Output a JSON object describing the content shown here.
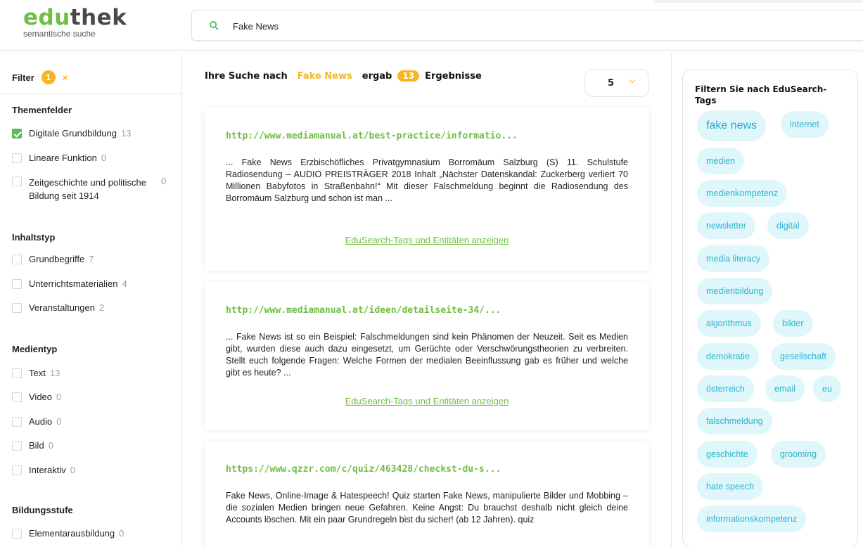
{
  "logo": {
    "brand_a": "edu",
    "brand_b": "thek",
    "subtitle": "semantische suche"
  },
  "search": {
    "value": "Fake News",
    "placeholder": ""
  },
  "filter": {
    "label": "Filter",
    "count": "1",
    "clear": "×",
    "sections": {
      "themenfelder": {
        "title": "Themenfelder",
        "items": [
          {
            "label": "Digitale Grundbildung",
            "count": "13",
            "checked": true
          },
          {
            "label": "Lineare Funktion",
            "count": "0"
          },
          {
            "label": "Zeitgeschichte und politische Bildung seit 1914",
            "count": "0"
          }
        ]
      },
      "inhaltstyp": {
        "title": "Inhaltstyp",
        "items": [
          {
            "label": "Grundbegriffe",
            "count": "7"
          },
          {
            "label": "Unterrichtsmaterialien",
            "count": "4"
          },
          {
            "label": "Veranstaltungen",
            "count": "2"
          }
        ]
      },
      "medientyp": {
        "title": "Medientyp",
        "items": [
          {
            "label": "Text",
            "count": "13"
          },
          {
            "label": "Video",
            "count": "0"
          },
          {
            "label": "Audio",
            "count": "0"
          },
          {
            "label": "Bild",
            "count": "0"
          },
          {
            "label": "Interaktiv",
            "count": "0"
          }
        ]
      },
      "bildungsstufe": {
        "title": "Bildungsstufe",
        "items": [
          {
            "label": "Elementarausbildung",
            "count": "0"
          }
        ]
      }
    }
  },
  "results": {
    "prefix": "Ihre Suche nach",
    "query": "Fake News",
    "middle": "ergab",
    "count": "13",
    "suffix": "Ergebnisse",
    "per_page": "5",
    "items": [
      {
        "url": "http://www.mediamanual.at/best-practice/informatio...",
        "snippet": "... Fake News Erzbischöfliches Privatgymnasium Borromäum Salzburg (S) 11. Schulstufe Radiosendung – AUDIO PREISTRÄGER 2018 Inhalt „Nächster Datenskandal: Zuckerberg verliert 70 Millionen Babyfotos in Straßenbahn!“ Mit dieser Falschmeldung beginnt die Radiosendung des Borromäum Salzburg und schon ist man ...",
        "more": "EduSearch-Tags und Entitäten anzeigen"
      },
      {
        "url": "http://www.mediamanual.at/ideen/detailseite-34/...",
        "snippet": "... Fake News ist so ein Beispiel: Falschmeldungen sind kein Phänomen der Neuzeit. Seit es Medien gibt, wurden diese auch dazu eingesetzt, um Gerüchte oder Verschwörungstheorien zu verbreiten. Stellt euch folgende Fragen: Welche Formen der medialen Beeinflussung gab es früher und welche gibt es heute? ...",
        "more": "EduSearch-Tags und Entitäten anzeigen"
      },
      {
        "url": "https://www.qzzr.com/c/quiz/463428/checkst-du-s...",
        "snippet": "Fake News, Online-Image & Hatespeech! Quiz starten Fake News, manipulierte Bilder und Mobbing – die sozialen Medien bringen neue Gefahren. Keine Angst: Du brauchst deshalb nicht gleich deine Accounts löschen. Mit ein paar Grundregeln bist du sicher! (ab 12 Jahren). quiz"
      }
    ]
  },
  "tags": {
    "title": "Filtern Sie nach EduSearch-Tags",
    "items": [
      "fake news",
      "internet",
      "medien",
      "medienkompetenz",
      "newsletter",
      "digital",
      "media literacy",
      "medienbildung",
      "algorithmus",
      "bilder",
      "demokratie",
      "gesellschaft",
      "österreich",
      "email",
      "eu",
      "falschmeldung",
      "geschichte",
      "grooming",
      "hate speech",
      "informationskompetenz"
    ]
  },
  "colors": {
    "brand_green": "#6fbe44",
    "accent_orange": "#f4b528",
    "tag_bg": "#dff7fb",
    "tag_text": "#2bb3d0"
  }
}
